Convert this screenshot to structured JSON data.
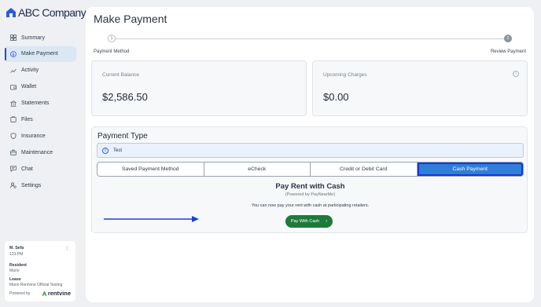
{
  "brand": {
    "name": "ABC Company"
  },
  "sidebar": {
    "items": [
      {
        "label": "Summary",
        "icon": "grid-icon"
      },
      {
        "label": "Make Payment",
        "icon": "dollar-icon",
        "active": true
      },
      {
        "label": "Activity",
        "icon": "trend-icon"
      },
      {
        "label": "Wallet",
        "icon": "wallet-icon"
      },
      {
        "label": "Statements",
        "icon": "bank-icon"
      },
      {
        "label": "Files",
        "icon": "files-icon"
      },
      {
        "label": "Insurance",
        "icon": "shield-icon"
      },
      {
        "label": "Maintenance",
        "icon": "toolbox-icon"
      },
      {
        "label": "Chat",
        "icon": "chat-icon"
      },
      {
        "label": "Settings",
        "icon": "user-gear-icon"
      }
    ]
  },
  "user_card": {
    "name": "M. Sefa",
    "time": "123 PM",
    "resident_label": "Resident",
    "resident_value": "Mario",
    "lease_label": "Lease",
    "lease_value": "Mario Rentvine Official Testing",
    "powered_by": "Powered by",
    "powered_brand": "rentvine"
  },
  "page": {
    "title": "Make Payment"
  },
  "stepper": {
    "steps": [
      {
        "number": "1",
        "label": "Payment Method"
      },
      {
        "number": "2",
        "label": "Review Payment"
      }
    ]
  },
  "cards": {
    "balance": {
      "label": "Current Balance",
      "value": "$2,586.50"
    },
    "upcoming": {
      "label": "Upcoming Charges",
      "value": "$0.00"
    }
  },
  "payment_type": {
    "title": "Payment Type",
    "alert": "Test",
    "tabs": [
      "Saved Payment Method",
      "eCheck",
      "Credit or Debit Card",
      "Cash Payment"
    ],
    "selected_tab": "Cash Payment",
    "cash": {
      "title": "Pay Rent with Cash",
      "subtitle": "(Powered by PayNearMe)",
      "description": "You can now pay your rent with cash at participating retailers.",
      "button": "Pay With Cash"
    }
  },
  "colors": {
    "accent": "#2f7fd8",
    "selected_outline": "#1537d6",
    "button_green": "#1e7a3a",
    "annotation_arrow": "#1d3fd6"
  }
}
